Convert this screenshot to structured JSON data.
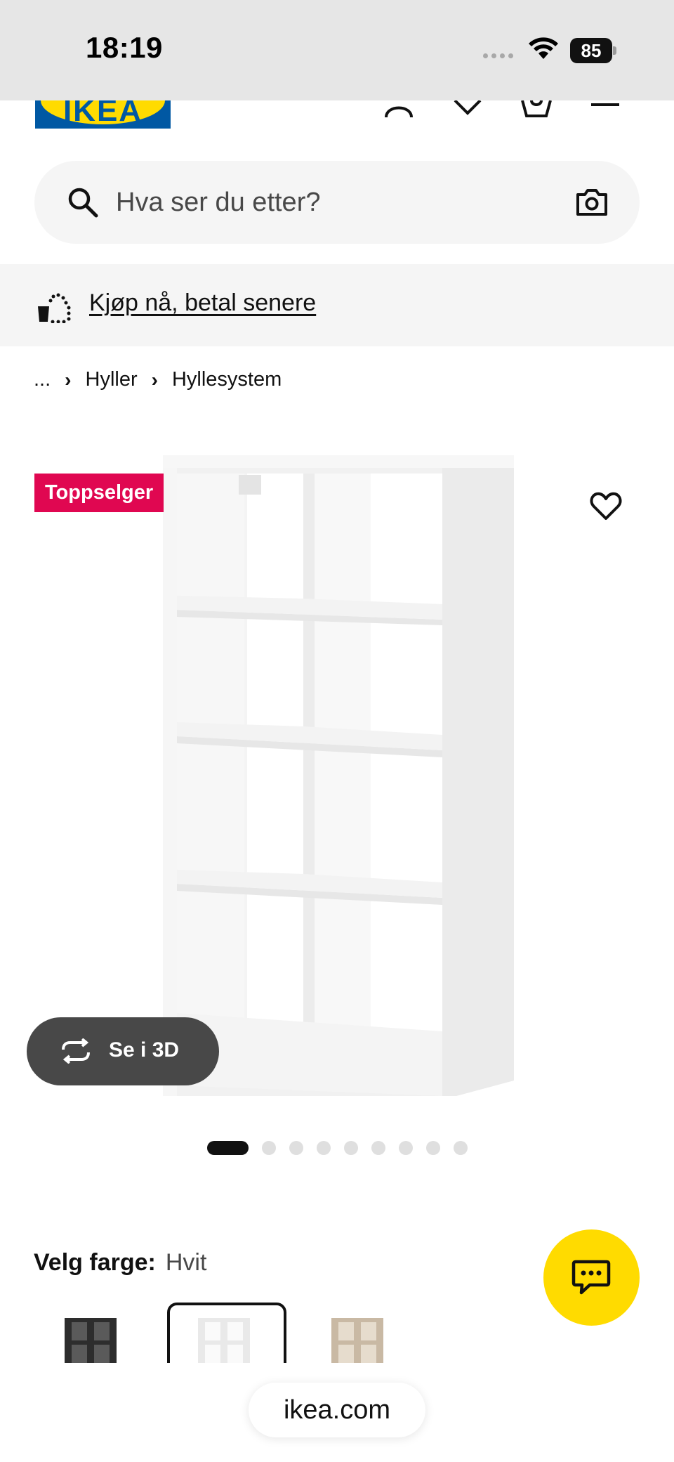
{
  "status_bar": {
    "time": "18:19",
    "battery_level": "85"
  },
  "header": {
    "logo_text": "IKEA",
    "icons": [
      "account-icon",
      "heart-icon",
      "shopping-bag-icon",
      "menu-icon"
    ]
  },
  "search": {
    "placeholder": "Hva ser du etter?",
    "camera_icon": "camera-icon"
  },
  "banner": {
    "link_text": "Kjøp nå, betal senere"
  },
  "breadcrumb": {
    "ellipsis": "...",
    "items": [
      "Hyller",
      "Hyllesystem"
    ]
  },
  "product": {
    "badge": "Toppselger",
    "view_3d_label": "Se i 3D",
    "image_count": 9,
    "active_image_index": 0
  },
  "color_selector": {
    "label": "Velg farge:",
    "selected_value": "Hvit",
    "options": [
      "black-brown",
      "white",
      "white-stained-oak"
    ]
  },
  "browser": {
    "url": "ikea.com"
  },
  "colors": {
    "ikea_blue": "#0058a3",
    "ikea_yellow": "#ffdb00",
    "badge_red": "#e00751",
    "dark_button": "#484848"
  }
}
